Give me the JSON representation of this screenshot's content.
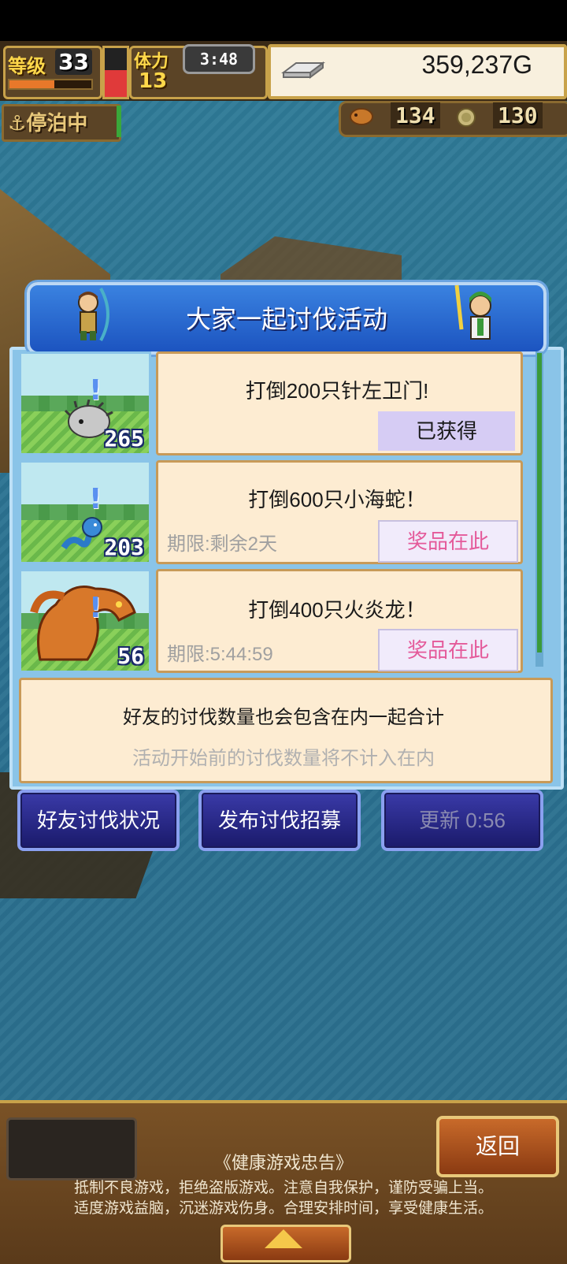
{
  "hud": {
    "level_label": "等级",
    "level_value": "33",
    "level_progress": 0.55,
    "stamina_label": "体力",
    "stamina_value": "13",
    "stamina_gauge_level": 0.55,
    "clock": "3:48",
    "gold_value": "359,237G",
    "anchor_label": "停泊中",
    "bait_count": "134",
    "medal_count": "130"
  },
  "dialog": {
    "title": "大家一起讨伐活动",
    "quests": [
      {
        "count": "265",
        "title": "打倒200只针左卫门!",
        "deadline": "",
        "button": "已获得",
        "button_state": "obtained"
      },
      {
        "count": "203",
        "title": "打倒600只小海蛇！",
        "deadline": "期限:剩余2天",
        "button": "奖品在此",
        "button_state": "reward"
      },
      {
        "count": "56",
        "title": "打倒400只火炎龙！",
        "deadline": "期限:5:44:59",
        "button": "奖品在此",
        "button_state": "reward"
      }
    ],
    "note_main": "好友的讨伐数量也会包含在内一起合计",
    "note_sub": "活动开始前的讨伐数量将不计入在内"
  },
  "actions": {
    "friends_status": "好友讨伐状况",
    "post_recruit": "发布讨伐招募",
    "refresh": "更新 0:56"
  },
  "bottom": {
    "back": "返回",
    "health_title": "《健康游戏忠告》",
    "health_line1": "抵制不良游戏，拒绝盗版游戏。注意自我保护，谨防受骗上当。",
    "health_line2": "适度游戏益脑，沉迷游戏伤身。合理安排时间，享受健康生活。"
  },
  "colors": {
    "dialog_blue": "#2a6ad8",
    "reward_pink": "#e45a9a",
    "gold_yellow": "#ffd84a"
  }
}
